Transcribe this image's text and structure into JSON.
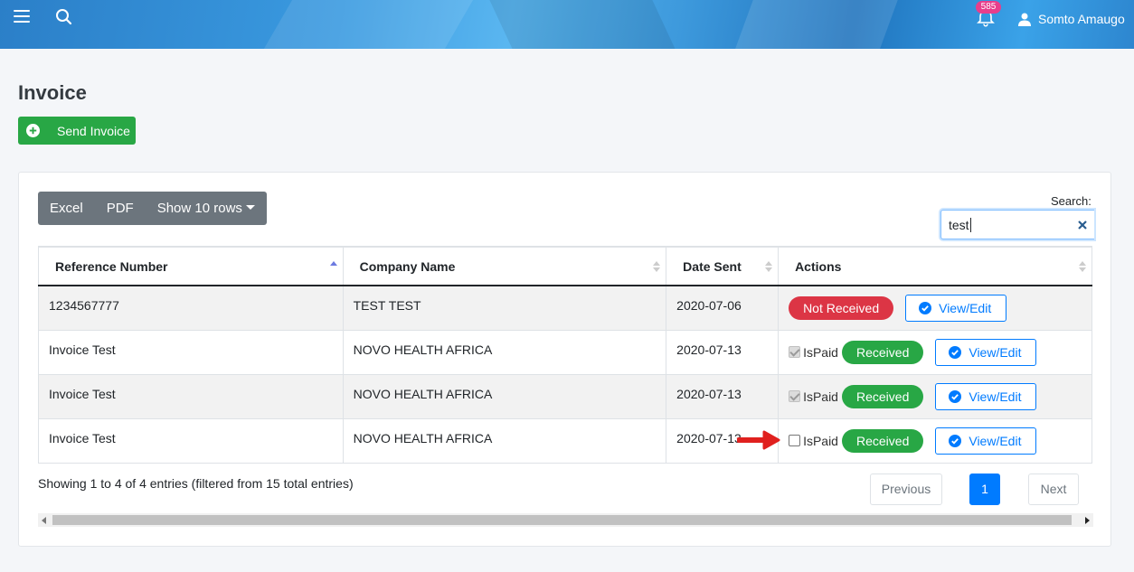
{
  "header": {
    "notification_count": "585",
    "user_name": "Somto Amaugo"
  },
  "page": {
    "title": "Invoice",
    "send_button_label": "Send Invoice"
  },
  "toolbar": {
    "excel_label": "Excel",
    "pdf_label": "PDF",
    "rows_label": "Show 10 rows"
  },
  "search": {
    "label": "Search:",
    "value": "test"
  },
  "table": {
    "headers": [
      "Reference Number",
      "Company Name",
      "Date Sent",
      "Actions"
    ],
    "rows": [
      {
        "ref": "1234567777",
        "company": "TEST TEST",
        "date": "2020-07-06",
        "status": "Not Received",
        "ispaid_label": "",
        "view_label": "View/Edit"
      },
      {
        "ref": "Invoice Test",
        "company": "NOVO HEALTH AFRICA",
        "date": "2020-07-13",
        "status": "Received",
        "ispaid_label": "IsPaid",
        "view_label": "View/Edit"
      },
      {
        "ref": "Invoice Test",
        "company": "NOVO HEALTH AFRICA",
        "date": "2020-07-13",
        "status": "Received",
        "ispaid_label": "IsPaid",
        "view_label": "View/Edit"
      },
      {
        "ref": "Invoice Test",
        "company": "NOVO HEALTH AFRICA",
        "date": "2020-07-13",
        "status": "Received",
        "ispaid_label": "IsPaid",
        "view_label": "View/Edit"
      }
    ]
  },
  "footer": {
    "info": "Showing 1 to 4 of 4 entries (filtered from 15 total entries)",
    "previous_label": "Previous",
    "page_number": "1",
    "next_label": "Next"
  },
  "colors": {
    "success": "#28a745",
    "danger": "#dc3545",
    "primary": "#007bff",
    "badge": "#e83e8c"
  },
  "icons": [
    "hamburger-icon",
    "search-icon",
    "bell-icon",
    "user-icon",
    "plus-circle-icon",
    "check-circle-icon",
    "close-icon",
    "sort-icon",
    "arrow-right-icon"
  ]
}
